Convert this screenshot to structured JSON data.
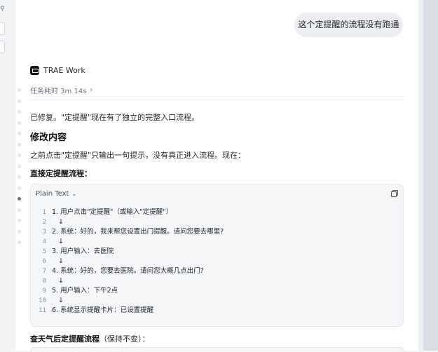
{
  "chat": {
    "user_message": "这个定提醒的流程没有跑通",
    "agent_name": "TRAE Work",
    "task_time": "任务耗时 3m 14s",
    "response": {
      "intro": "已修复。\"定提醒\"现在有了独立的完整入口流程。",
      "heading": "修改内容",
      "desc": "之前点击\"定提醒\"只输出一句提示，没有真正进入流程。现在：",
      "subheading": "直接定提醒流程：",
      "code_lang": "Plain Text",
      "code_lines": [
        {
          "n": "1",
          "t": "1. 用户点击\"定提醒\"（或输入\"定提醒\"）"
        },
        {
          "n": "2",
          "t": "   ↓"
        },
        {
          "n": "3",
          "t": "2. 系统：好的，我来帮您设置出门提醒。请问您要去哪里?"
        },
        {
          "n": "4",
          "t": "   ↓"
        },
        {
          "n": "5",
          "t": "3. 用户输入：去医院"
        },
        {
          "n": "6",
          "t": "   ↓"
        },
        {
          "n": "7",
          "t": "4. 系统：好的，您要去医院。请问您大概几点出门?"
        },
        {
          "n": "8",
          "t": "   ↓"
        },
        {
          "n": "9",
          "t": "5. 用户输入：下午2点"
        },
        {
          "n": "10",
          "t": "   ↓"
        },
        {
          "n": "11",
          "t": "6. 系统显示提醒卡片：已设置提醒"
        }
      ],
      "weather_title_bold": "查天气后定提醒流程",
      "weather_title_rest": "（保持不变）："
    }
  },
  "icons": {
    "agent_logo": "trae-logo-icon",
    "chevron": "chevron-right-icon",
    "lang_chevron": "chevron-down-icon",
    "copy": "copy-icon"
  }
}
